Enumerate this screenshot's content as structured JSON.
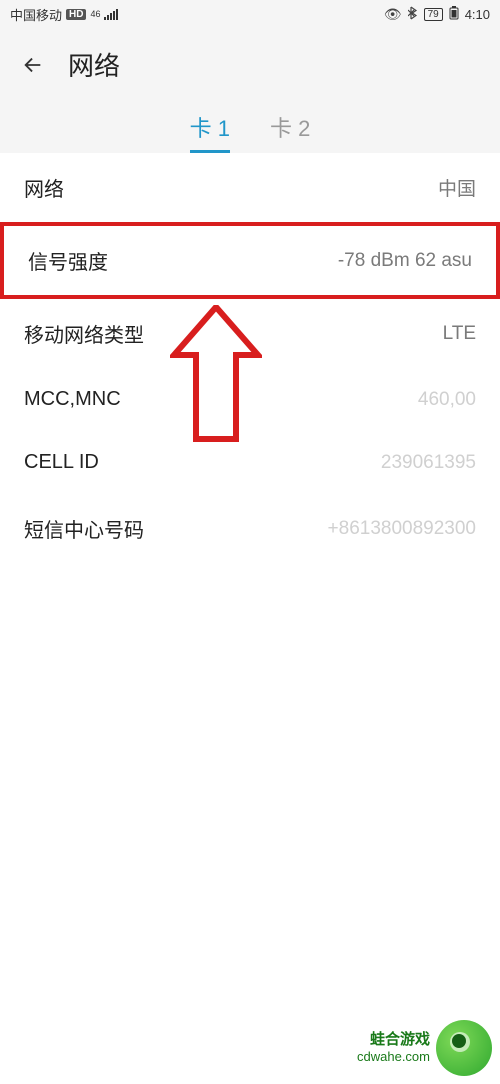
{
  "status": {
    "carrier": "中国移动",
    "hd": "HD",
    "net": "46",
    "battery": "79",
    "time": "4:10"
  },
  "header": {
    "title": "网络"
  },
  "tabs": {
    "card1": "卡 1",
    "card2": "卡 2"
  },
  "rows": {
    "network": {
      "label": "网络",
      "value": "中国"
    },
    "signal": {
      "label": "信号强度",
      "value": "-78 dBm  62 asu"
    },
    "nettype": {
      "label": "移动网络类型",
      "value": "LTE"
    },
    "mccmnc": {
      "label": "MCC,MNC",
      "value": "460,00"
    },
    "cellid": {
      "label": "CELL ID",
      "value": "239061395"
    },
    "smsc": {
      "label": "短信中心号码",
      "value": "+8613800892300"
    }
  },
  "watermark": {
    "name": "蛙合游戏",
    "domain": "cdwahe.com"
  }
}
